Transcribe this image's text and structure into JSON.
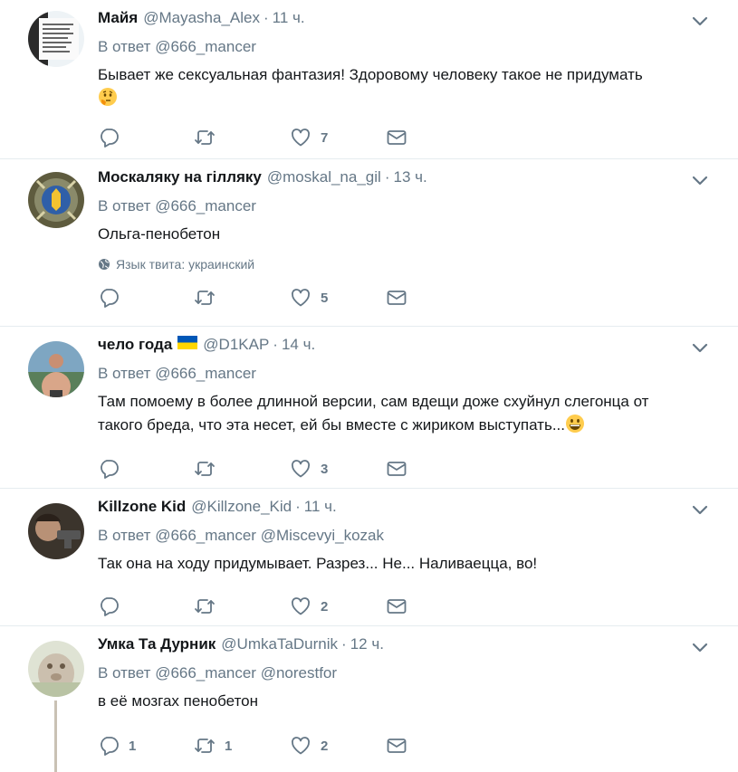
{
  "colors": {
    "text": "#14171a",
    "secondary": "#657786",
    "divider": "#e6ecf0",
    "icon": "#657786"
  },
  "tweets": [
    {
      "fullname": "Майя",
      "username": "@Mayasha_Alex",
      "separator": "·",
      "time": "11 ч.",
      "reply_prefix": "В ответ",
      "mentions": [
        "@666_mancer"
      ],
      "text": "Бывает же сексуальная фантазия!  Здоровому человеку такое не придумать",
      "emoji": "thinking-face",
      "reply_count": "",
      "retweet_count": "",
      "like_count": "7"
    },
    {
      "fullname": "Москаляку на гілляку",
      "username": "@moskal_na_gil",
      "separator": "·",
      "time": "13 ч.",
      "reply_prefix": "В ответ",
      "mentions": [
        "@666_mancer"
      ],
      "text": "Ольга-пенобетон",
      "language_note": "Язык твита: украинский",
      "reply_count": "",
      "retweet_count": "",
      "like_count": "5"
    },
    {
      "fullname": "чело года",
      "username": "@D1KAP",
      "separator": "·",
      "time": "14 ч.",
      "reply_prefix": "В ответ",
      "mentions": [
        "@666_mancer"
      ],
      "text_line1": "Там помоему в более длинной версии, сам вдещи доже схуйнул слегонца от",
      "text_line2": "такого бреда, что эта несет, ей бы вместе с жириком выступать...",
      "emoji": "grinning-face",
      "reply_count": "",
      "retweet_count": "",
      "like_count": "3"
    },
    {
      "fullname": "Killzone Kid",
      "username": "@Killzone_Kid",
      "separator": "·",
      "time": "11 ч.",
      "reply_prefix": "В ответ",
      "mentions": [
        "@666_mancer",
        "@Miscevyi_kozak"
      ],
      "text": "Так она на ходу придумывает. Разрез... Не... Наливаецца, во!",
      "reply_count": "",
      "retweet_count": "",
      "like_count": "2"
    },
    {
      "fullname": "Умка Та Дурник",
      "username": "@UmkaTaDurnik",
      "separator": "·",
      "time": "12 ч.",
      "reply_prefix": "В ответ",
      "mentions": [
        "@666_mancer",
        "@norestfor"
      ],
      "text": "в её мозгах пенобетон",
      "reply_count": "1",
      "retweet_count": "1",
      "like_count": "2"
    }
  ]
}
